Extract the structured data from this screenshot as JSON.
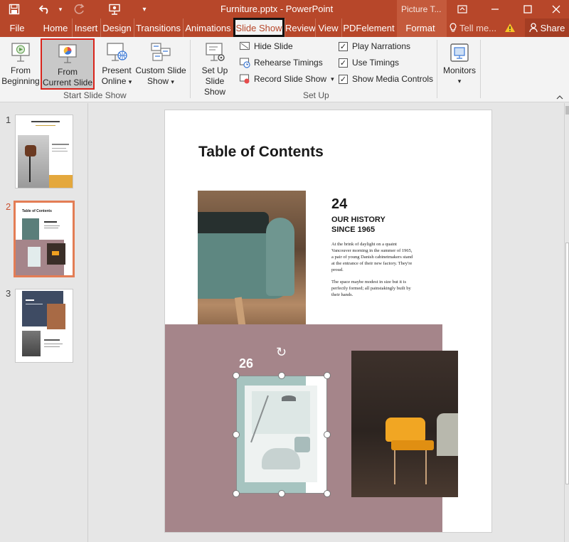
{
  "titlebar": {
    "title": "Furniture.pptx - PowerPoint",
    "context_group": "Picture T...",
    "save_icon": "save-icon",
    "undo_icon": "undo-icon",
    "redo_icon": "redo-icon",
    "present_icon": "present-icon",
    "customize_icon": "customize-qat-icon"
  },
  "tabs": {
    "file": "File",
    "home": "Home",
    "insert": "Insert",
    "design": "Design",
    "transitions": "Transitions",
    "animations": "Animations",
    "slideshow": "Slide Show",
    "review": "Review",
    "view": "View",
    "pdfelement": "PDFelement",
    "format": "Format",
    "tellme": "Tell me...",
    "share": "Share"
  },
  "ribbon": {
    "from_beginning_1": "From",
    "from_beginning_2": "Beginning",
    "from_current_1": "From",
    "from_current_2": "Current Slide",
    "present_online_1": "Present",
    "present_online_2": "Online",
    "custom_show_1": "Custom Slide",
    "custom_show_2": "Show",
    "group_start": "Start Slide Show",
    "setup_show_1": "Set Up",
    "setup_show_2": "Slide Show",
    "hide_slide": "Hide Slide",
    "rehearse": "Rehearse Timings",
    "record": "Record Slide Show",
    "play_narrations": "Play Narrations",
    "use_timings": "Use Timings",
    "show_media": "Show Media Controls",
    "group_setup": "Set Up",
    "monitors": "Monitors",
    "dropdown_arrow": "▾"
  },
  "checks": {
    "narrations": "✓",
    "timings": "✓",
    "media": "✓"
  },
  "thumbs": {
    "n1": "1",
    "n2": "2",
    "n3": "3",
    "t2_title": "Table of Contents"
  },
  "slide": {
    "title": "Table of Contents",
    "num1": "24",
    "heading1": "OUR HISTORY",
    "heading2": "SINCE 1965",
    "para1": "At the brink of daylight on a quaint Vancouver morning in the summer of 1965, a pair of young Danish cabinetmakers stand at the entrance of their new factory. They're proud.",
    "para2": "The space maybe modest in size but it is perfectly formed; all painstakingly built by their hands.",
    "num2": "26",
    "rotate": "↻"
  },
  "colors": {
    "brand": "#b7472a",
    "ribbon_bg": "#f3f3f3",
    "mauve": "#a5858a",
    "selected_thumb_border": "#e37d55",
    "highlight_border": "#d9241b"
  }
}
